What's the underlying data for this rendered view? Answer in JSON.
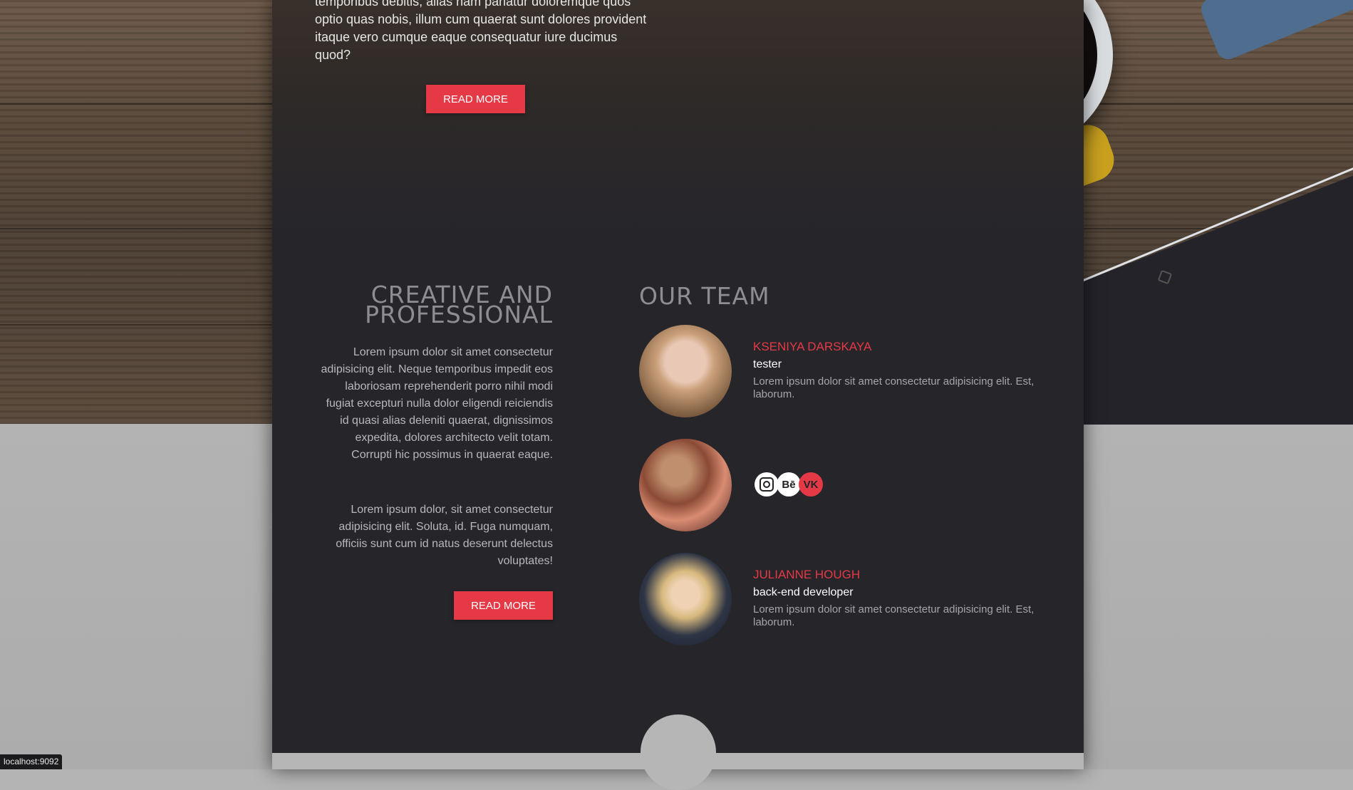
{
  "intro": {
    "text": "temporibus debitis, alias nam pariatur doloremque quos optio quas nobis, illum cum quaerat sunt dolores provident itaque vero cumque eaque consequatur iure ducimus quod?",
    "button_label": "READ MORE"
  },
  "creative": {
    "title_line1": "CREATIVE AND",
    "title_line2": "PROFESSIONAL",
    "paragraph1": "Lorem ipsum dolor sit amet consectetur adipisicing elit. Neque temporibus impedit eos laboriosam reprehenderit porro nihil modi fugiat excepturi nulla dolor eligendi reiciendis id quasi alias deleniti quaerat, dignissimos expedita, dolores architecto velit totam. Corrupti hic possimus in quaerat eaque.",
    "paragraph2": "Lorem ipsum dolor, sit amet consectetur adipisicing elit. Soluta, id. Fuga numquam, officiis sunt cum id natus deserunt delectus voluptates!",
    "button_label": "READ MORE"
  },
  "team": {
    "title": "OUR TEAM",
    "members": [
      {
        "name": "KSENIYA DARSKAYA",
        "role": "tester",
        "description": "Lorem ipsum dolor sit amet consectetur adipisicing elit. Est, laborum."
      },
      {
        "socials": [
          "instagram-icon",
          "behance-icon",
          "vk-icon"
        ],
        "behance_label": "Bē",
        "vk_label": "VK"
      },
      {
        "name": "JULIANNE HOUGH",
        "role": "back-end developer",
        "description": "Lorem ipsum dolor sit amet consectetur adipisicing elit. Est, laborum."
      }
    ]
  },
  "status_bar": {
    "url": "localhost:9092"
  },
  "colors": {
    "accent": "#e63946",
    "panel": "#26252a",
    "heading": "#8e8e92"
  }
}
